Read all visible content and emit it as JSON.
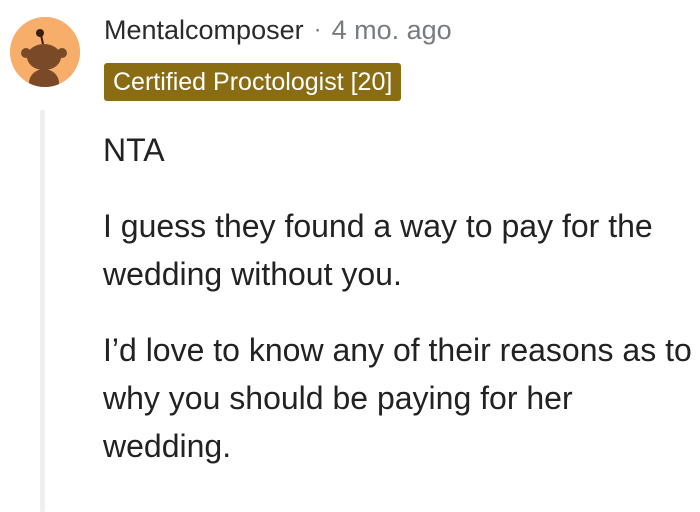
{
  "comment": {
    "username": "Mentalcomposer",
    "separator": "·",
    "timestamp": "4 mo. ago",
    "flair": "Certified Proctologist [20]",
    "flair_color": "#8a6d13",
    "avatar_color": "#f6ae6a",
    "avatar_icon": "reddit-snoo-icon",
    "paragraphs": [
      "NTA",
      "I guess they found a way to pay for the wedding without you.",
      "I’d love to know any of their reasons as to why you should be paying for her wedding."
    ]
  }
}
